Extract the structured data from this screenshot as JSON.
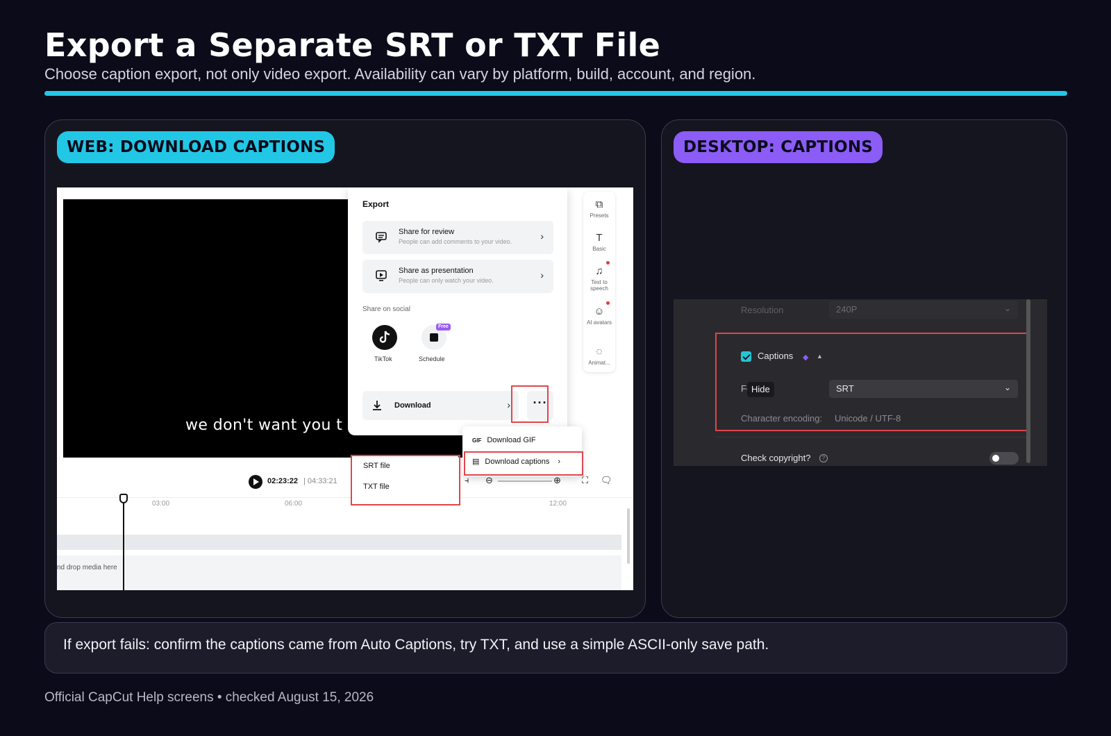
{
  "header": {
    "title": "Export a Separate SRT or TXT File",
    "subtitle": "Choose caption export, not only video export. Availability can vary by platform, build, account, and region."
  },
  "colors": {
    "accent": "#22c7e6",
    "purple": "#8b5cf6",
    "highlight": "#e0454c",
    "background": "#0b0b1a"
  },
  "web": {
    "badge": "WEB: DOWNLOAD CAPTIONS",
    "video_caption": "we don't want you to",
    "export": {
      "title": "Export",
      "share_review": {
        "label": "Share for review",
        "sub": "People can add comments to your video."
      },
      "share_presentation": {
        "label": "Share as presentation",
        "sub": "People can only watch your video."
      },
      "social_label": "Share on social",
      "tiktok": "TikTok",
      "schedule": "Schedule",
      "free_badge": "Free",
      "download": "Download",
      "more": "···"
    },
    "tools": [
      {
        "icon": "presets-icon",
        "label": "Presets"
      },
      {
        "icon": "text-icon",
        "label": "Basic"
      },
      {
        "icon": "speech-icon",
        "label": "Text to speech"
      },
      {
        "icon": "ai-avatars-icon",
        "label": "AI avatars"
      },
      {
        "icon": "animation-icon",
        "label": "Animat..."
      }
    ],
    "download_menu": {
      "gif_tag": "GIF",
      "gif": "Download GIF",
      "captions": "Download captions"
    },
    "caption_formats": {
      "srt": "SRT file",
      "txt": "TXT file"
    },
    "timeline": {
      "current": "02:23:22",
      "separator": "|",
      "total": "04:33:21",
      "ticks": [
        "03:00",
        "06:00",
        "12:00"
      ],
      "drop_hint": "nd drop media here"
    }
  },
  "desktop": {
    "badge": "DESKTOP: CAPTIONS",
    "resolution_label": "Resolution",
    "resolution_value": "240P",
    "captions_label": "Captions",
    "format_label_partial": "Fo",
    "tooltip": "Hide",
    "format_value": "SRT",
    "encoding_label": "Character encoding:",
    "encoding_value": "Unicode / UTF-8",
    "copyright_label": "Check copyright?"
  },
  "note": "If export fails: confirm the captions came from Auto Captions, try TXT, and use a simple ASCII-only save path.",
  "footer": "Official CapCut Help screens • checked August 15, 2026"
}
